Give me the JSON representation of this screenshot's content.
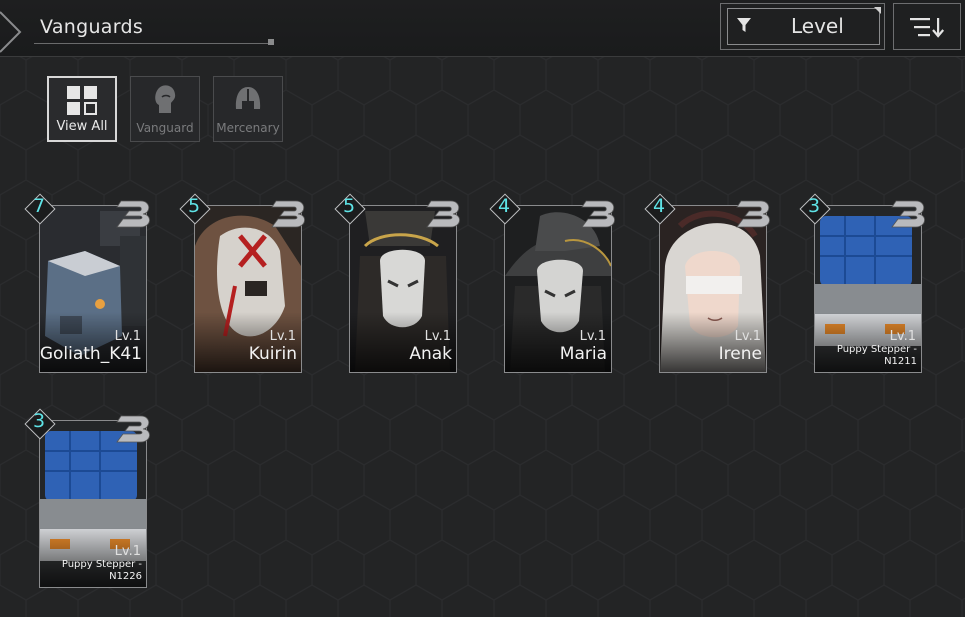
{
  "header": {
    "title": "Vanguards",
    "filter_label": "Level"
  },
  "tabs": [
    {
      "label": "View All",
      "icon": "grid-icon",
      "active": true
    },
    {
      "label": "Vanguard",
      "icon": "head-icon",
      "active": false
    },
    {
      "label": "Mercenary",
      "icon": "helmet-icon",
      "active": false
    }
  ],
  "cards": [
    {
      "name": "Goliath_K41",
      "level": "Lv.1",
      "rank": "7",
      "badge": "B",
      "art": "mech"
    },
    {
      "name": "Kuirin",
      "level": "Lv.1",
      "rank": "5",
      "badge": "B",
      "art": "kuirin"
    },
    {
      "name": "Anak",
      "level": "Lv.1",
      "rank": "5",
      "badge": "B",
      "art": "mask-gold"
    },
    {
      "name": "Maria",
      "level": "Lv.1",
      "rank": "4",
      "badge": "B",
      "art": "mask-hat"
    },
    {
      "name": "Irene",
      "level": "Lv.1",
      "rank": "4",
      "badge": "B",
      "art": "irene"
    },
    {
      "name_line1": "Puppy Stepper -",
      "name_line2": "N1211",
      "level": "Lv.1",
      "rank": "3",
      "badge": "B",
      "art": "truck"
    },
    {
      "name_line1": "Puppy Stepper -",
      "name_line2": "N1226",
      "level": "Lv.1",
      "rank": "3",
      "badge": "B",
      "art": "truck"
    }
  ],
  "colors": {
    "rank_text": "#5ee3e6",
    "background": "#232425"
  }
}
